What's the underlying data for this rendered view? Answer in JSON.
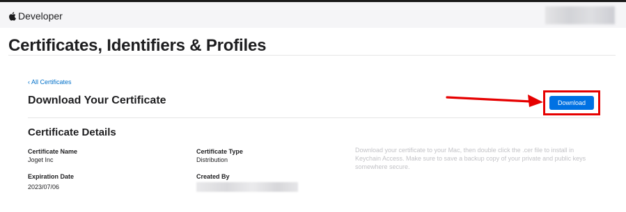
{
  "header": {
    "brand": "Developer"
  },
  "page": {
    "title": "Certificates, Identifiers & Profiles",
    "back_link": "‹ All Certificates",
    "section_title": "Download Your Certificate",
    "download_label": "Download"
  },
  "details": {
    "title": "Certificate Details",
    "fields": [
      {
        "label": "Certificate Name",
        "value": "Joget Inc"
      },
      {
        "label": "Certificate Type",
        "value": "Distribution"
      },
      {
        "label": "Expiration Date",
        "value": "2023/07/06"
      },
      {
        "label": "Created By",
        "value": ""
      }
    ],
    "info": "Download your certificate to your Mac, then double click the .cer file to install in Keychain Access. Make sure to save a backup copy of your private and public keys somewhere secure."
  },
  "colors": {
    "accent": "#0071e3",
    "highlight": "#e60000",
    "link": "#0070c9"
  },
  "icons": {
    "brand": "apple-logo-icon",
    "annotation": "red-arrow-icon"
  }
}
